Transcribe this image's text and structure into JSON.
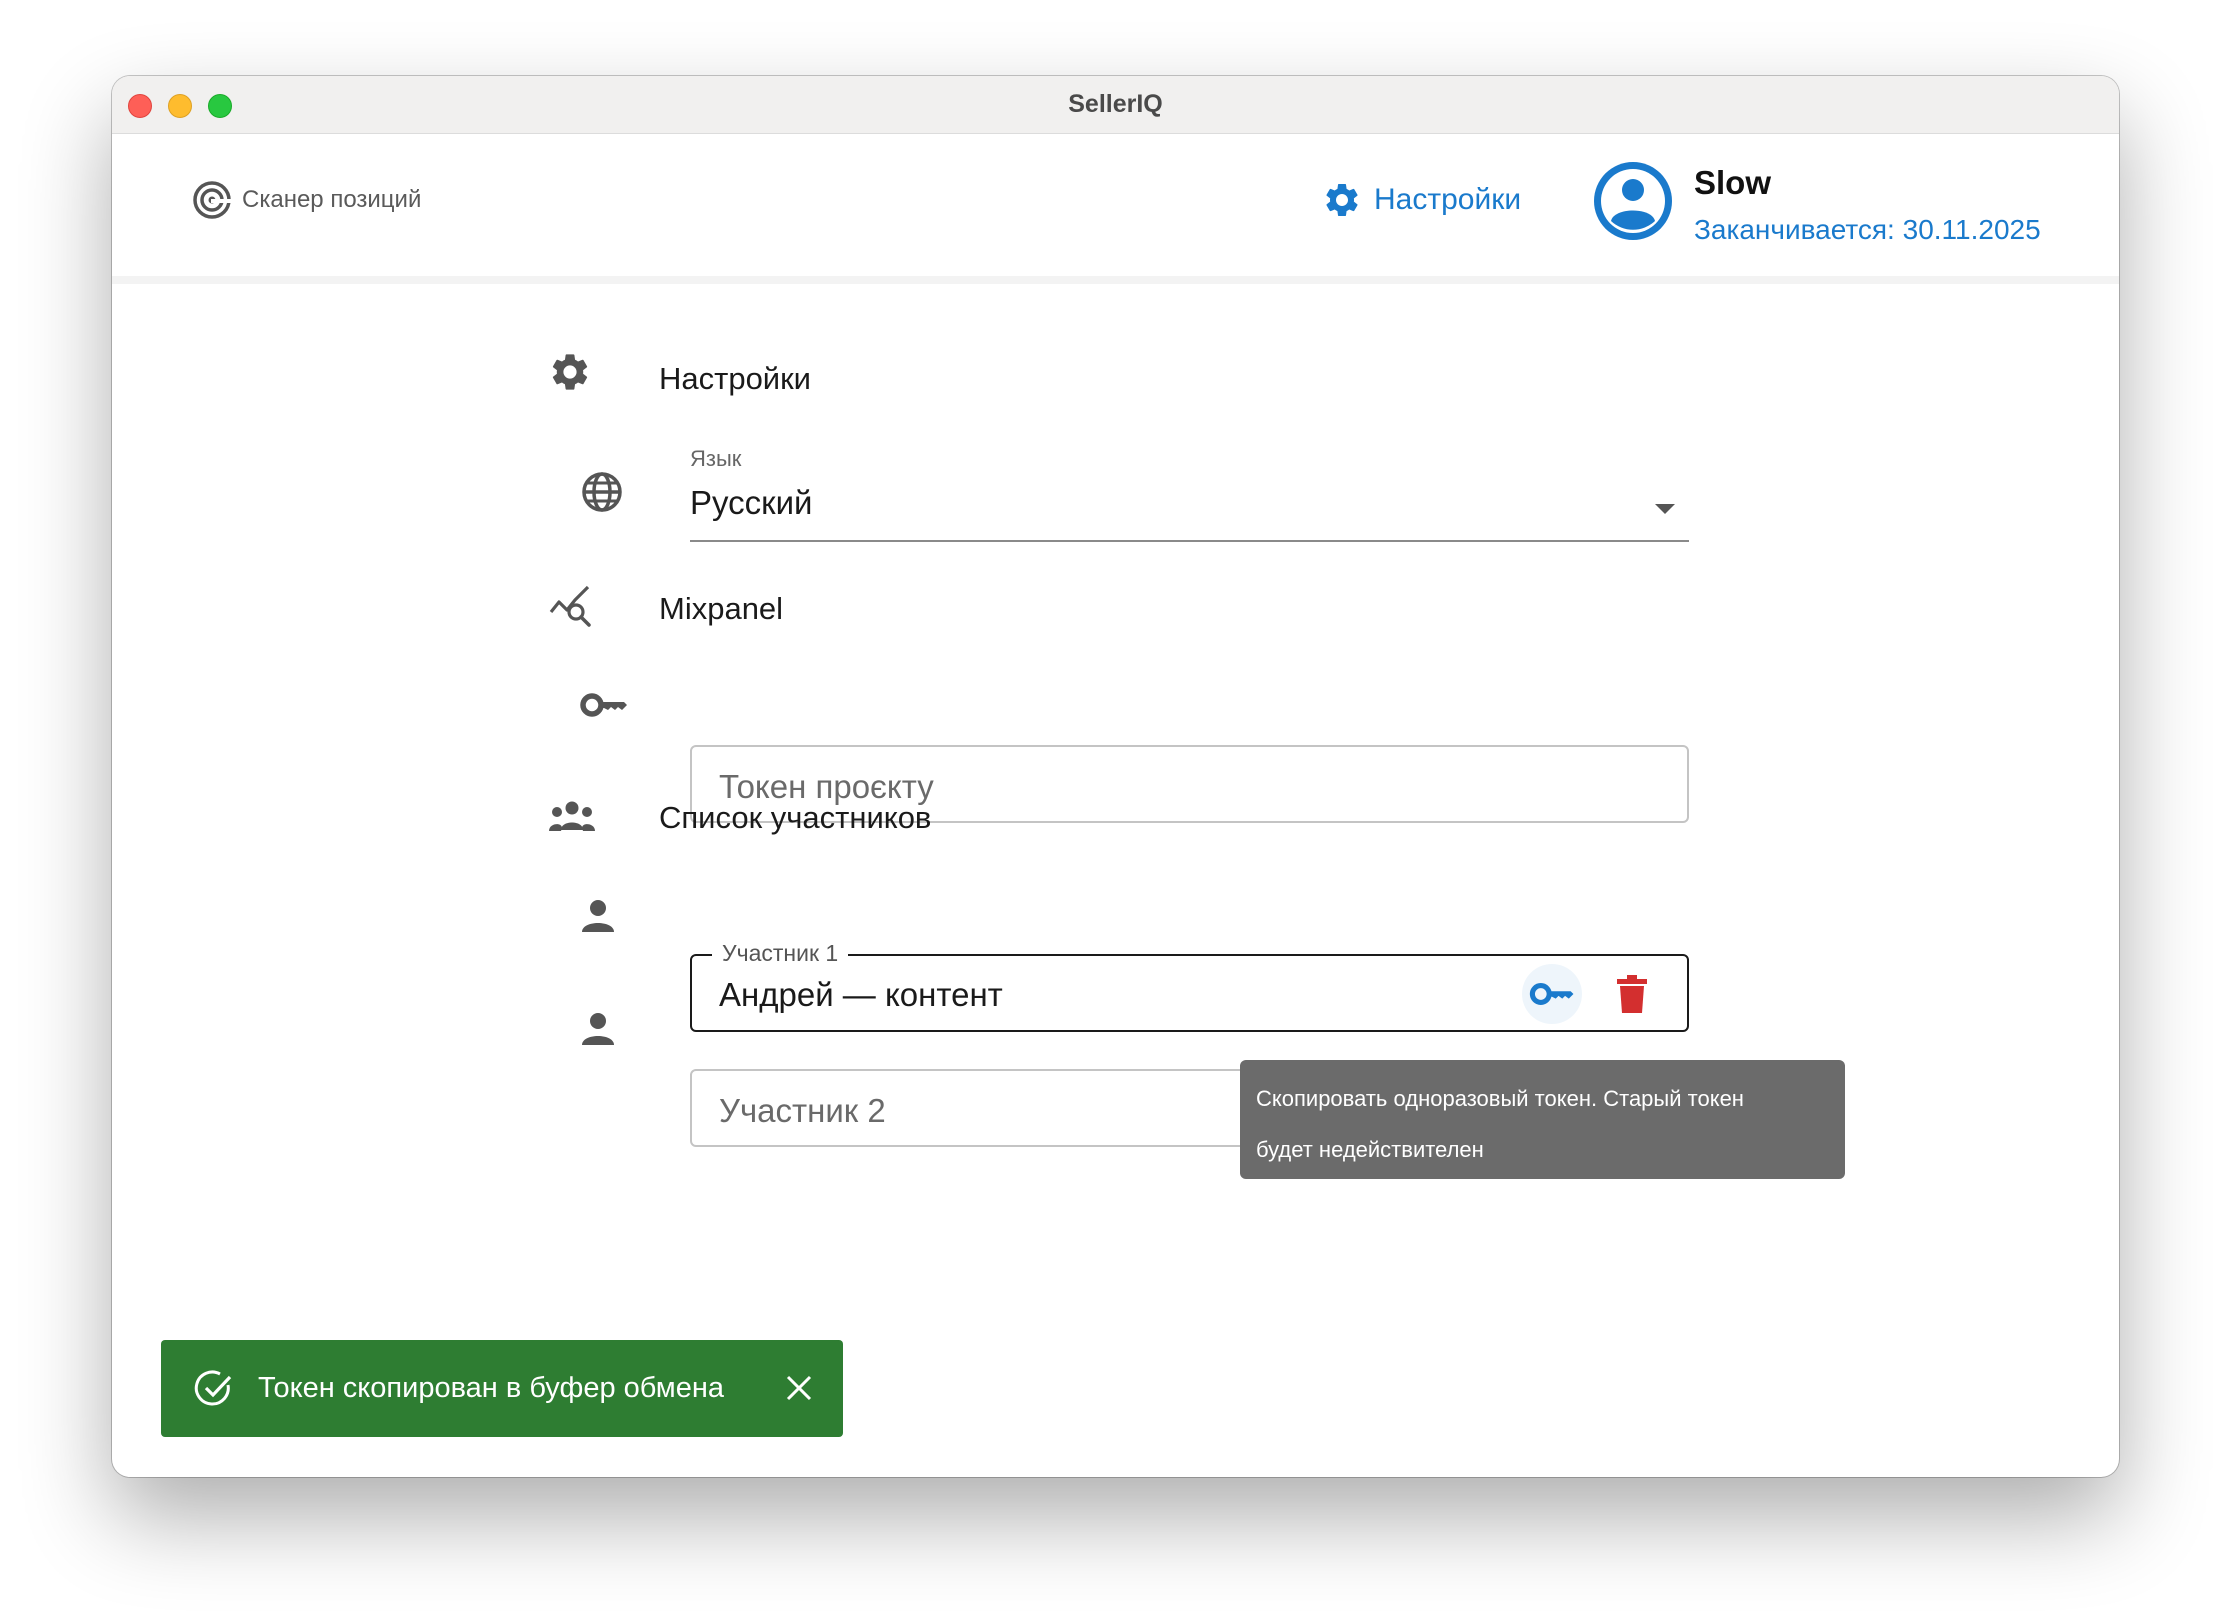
{
  "window": {
    "title": "SellerIQ"
  },
  "nav": {
    "scanner_label": "Сканер позиций",
    "settings_label": "Настройки",
    "user": {
      "name": "Slow",
      "subscription": "Заканчивается: 30.11.2025"
    }
  },
  "settings": {
    "title": "Настройки",
    "language": {
      "label": "Язык",
      "value": "Русский"
    },
    "mixpanel": {
      "title": "Mixpanel",
      "token_placeholder": "Токен проєкту"
    },
    "members": {
      "title": "Список участников",
      "items": [
        {
          "label": "Участник 1",
          "value": "Андрей — контент"
        },
        {
          "placeholder": "Участник 2"
        }
      ]
    }
  },
  "tooltip": {
    "text_line1": "Скопировать одноразовый токен. Старый токен",
    "text_line2": "будет недействителен"
  },
  "snackbar": {
    "message": "Токен скопирован в буфер обмена"
  },
  "colors": {
    "accent": "#1a7acc",
    "success": "#2e7d32",
    "danger": "#d32f2f",
    "tooltip": "#6b6b6b"
  }
}
